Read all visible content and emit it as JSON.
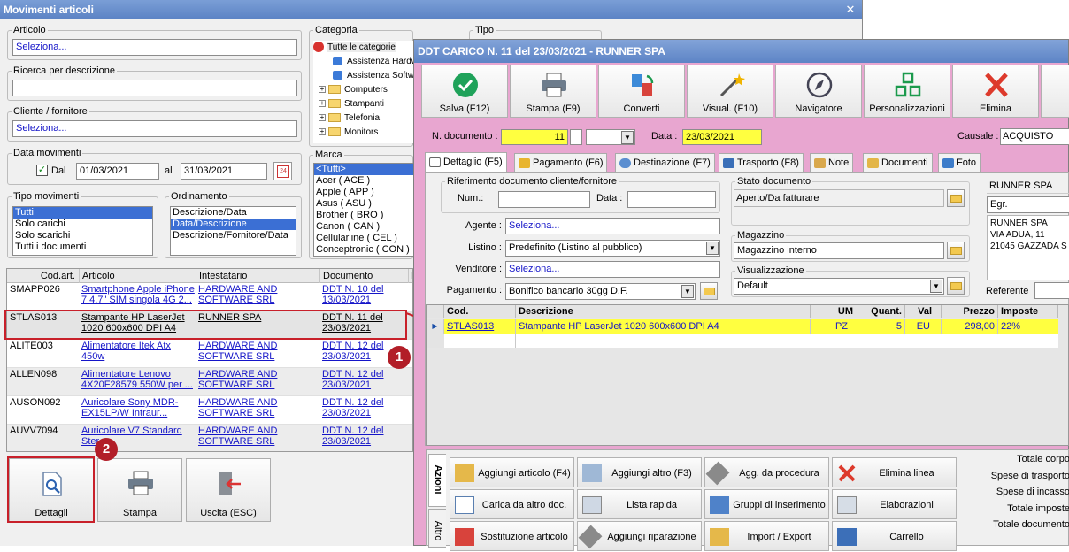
{
  "main": {
    "title": "Movimenti articoli",
    "articolo": {
      "label": "Articolo",
      "value": "Seleziona..."
    },
    "ricerca": {
      "label": "Ricerca per descrizione",
      "value": ""
    },
    "cliente": {
      "label": "Cliente / fornitore",
      "value": "Seleziona..."
    },
    "data_mov": {
      "label": "Data movimenti",
      "dal_label": "Dal",
      "dal": "01/03/2021",
      "al_label": "al",
      "al": "31/03/2021",
      "calendar_day": "24"
    },
    "tipo_mov": {
      "label": "Tipo movimenti",
      "items": [
        "Tutti",
        "Solo carichi",
        "Solo scarichi",
        "Tutti i documenti"
      ]
    },
    "ordinamento": {
      "label": "Ordinamento",
      "items": [
        "Descrizione/Data",
        "Data/Descrizione",
        "Descrizione/Fornitore/Data"
      ]
    },
    "categoria": {
      "label": "Categoria",
      "items": [
        "Tutte le categorie",
        "Assistenza Hardw",
        "Assistenza Softwa",
        "Computers",
        "Stampanti",
        "Telefonia",
        "Monitors"
      ]
    },
    "tipo_label": "Tipo",
    "marca": {
      "label": "Marca",
      "items": [
        "<Tutti>",
        "Acer ( ACE )",
        "Apple ( APP )",
        "Asus ( ASU )",
        "Brother ( BRO )",
        "Canon ( CAN )",
        "Cellularline ( CEL )",
        "Conceptronic ( CON )"
      ]
    },
    "grid": {
      "headers": [
        "Cod.art.",
        "Articolo",
        "Intestatario",
        "Documento",
        "D"
      ],
      "rows": [
        {
          "cod": "SMAPP026",
          "art": "Smartphone Apple iPhone 7 4.7\" SIM singola 4G 2...",
          "int": "HARDWARE AND SOFTWARE SRL",
          "doc": "DDT N. 10 del 13/03/2021"
        },
        {
          "cod": "STLAS013",
          "art": "Stampante HP LaserJet 1020 600x600 DPI A4",
          "int": "RUNNER SPA",
          "doc": "DDT N. 11 del 23/03/2021"
        },
        {
          "cod": "ALITE003",
          "art": "Alimentatore Itek Atx 450w",
          "int": "HARDWARE AND SOFTWARE SRL",
          "doc": "DDT N. 12 del 23/03/2021"
        },
        {
          "cod": "ALLEN098",
          "art": "Alimentatore Lenovo 4X20F28579 550W per ...",
          "int": "HARDWARE AND SOFTWARE SRL",
          "doc": "DDT N. 12 del 23/03/2021"
        },
        {
          "cod": "AUSON092",
          "art": "Auricolare Sony MDR-EX15LP/W Intraur...",
          "int": "HARDWARE AND SOFTWARE SRL",
          "doc": "DDT N. 12 del 23/03/2021"
        },
        {
          "cod": "AUVV7094",
          "art": "Auricolare V7 Standard Ster...",
          "int": "HARDWARE AND SOFTWARE SRL",
          "doc": "DDT N. 12 del 23/03/2021"
        }
      ]
    },
    "buttons": {
      "dettagli": "Dettagli",
      "stampa": "Stampa",
      "uscita": "Uscita (ESC)"
    },
    "badges": {
      "one": "1",
      "two": "2"
    }
  },
  "ddt": {
    "title": "DDT CARICO N. 11 del 23/03/2021 - RUNNER SPA",
    "toolbar": [
      "Salva (F12)",
      "Stampa (F9)",
      "Converti",
      "Visual. (F10)",
      "Navigatore",
      "Personalizzazioni",
      "Elimina"
    ],
    "ndoc_label": "N. documento :",
    "ndoc": "11",
    "data_label": "Data :",
    "data": "23/03/2021",
    "causale_label": "Causale :",
    "causale": "ACQUISTO",
    "tabs": [
      "Dettaglio (F5)",
      "Pagamento (F6)",
      "Destinazione (F7)",
      "Trasporto (F8)",
      "Note",
      "Documenti",
      "Foto"
    ],
    "rif": {
      "label": "Riferimento documento cliente/fornitore",
      "num_label": "Num.:",
      "data_label": "Data :"
    },
    "agente": {
      "label": "Agente :",
      "value": "Seleziona..."
    },
    "listino": {
      "label": "Listino :",
      "value": "Predefinito (Listino al pubblico)"
    },
    "venditore": {
      "label": "Venditore :",
      "value": "Seleziona..."
    },
    "pagamento": {
      "label": "Pagamento :",
      "value": "Bonifico bancario 30gg D.F."
    },
    "stato": {
      "label": "Stato documento",
      "value": "Aperto/Da fatturare"
    },
    "magazzino": {
      "label": "Magazzino",
      "value": "Magazzino interno"
    },
    "visualizzazione": {
      "label": "Visualizzazione",
      "value": "Default"
    },
    "intestatario": {
      "name": "RUNNER SPA",
      "title": "Egr.",
      "lines": [
        "RUNNER SPA",
        "VIA ADUA, 11",
        "21045 GAZZADA S"
      ]
    },
    "referente_label": "Referente",
    "lines": {
      "headers": [
        "Cod.",
        "Descrizione",
        "UM",
        "Quant.",
        "Val",
        "Prezzo",
        "Imposte"
      ],
      "rows": [
        {
          "cod": "STLAS013",
          "desc": "Stampante HP LaserJet 1020 600x600 DPI A4",
          "um": "PZ",
          "qty": "5",
          "val": "EU",
          "price": "298,00",
          "tax": "22%"
        }
      ]
    },
    "side_tabs": [
      "Azioni",
      "Altro"
    ],
    "actions": [
      "Aggiungi articolo (F4)",
      "Aggiungi altro (F3)",
      "Agg. da procedura",
      "Elimina linea",
      "Carica da altro doc.",
      "Lista rapida",
      "Gruppi di inserimento",
      "Elaborazioni",
      "Sostituzione articolo",
      "Aggiungi riparazione",
      "Import / Export",
      "Carrello"
    ],
    "totals": [
      "Totale corpo",
      "Spese di trasporto",
      "Spese di incasso",
      "Totale imposte",
      "Totale documento"
    ]
  }
}
